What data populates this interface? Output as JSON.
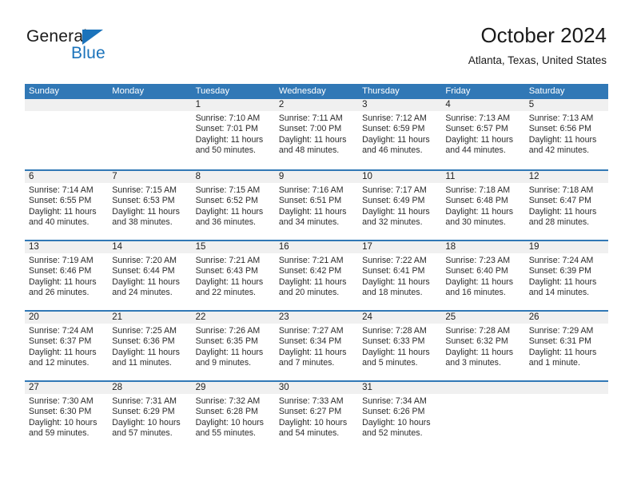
{
  "brand": {
    "name_top": "General",
    "name_bottom": "Blue",
    "color_dark": "#1a1a1a",
    "color_blue": "#1b73bb"
  },
  "header": {
    "title": "October 2024",
    "subtitle": "Atlanta, Texas, United States"
  },
  "theme": {
    "header_blue": "#3178b6",
    "daynum_band": "#f0f0f0",
    "text": "#2b2b2b"
  },
  "weekdays": [
    "Sunday",
    "Monday",
    "Tuesday",
    "Wednesday",
    "Thursday",
    "Friday",
    "Saturday"
  ],
  "weeks": [
    [
      {
        "day": "",
        "sunrise": "",
        "sunset": "",
        "daylight1": "",
        "daylight2": ""
      },
      {
        "day": "",
        "sunrise": "",
        "sunset": "",
        "daylight1": "",
        "daylight2": ""
      },
      {
        "day": "1",
        "sunrise": "Sunrise: 7:10 AM",
        "sunset": "Sunset: 7:01 PM",
        "daylight1": "Daylight: 11 hours",
        "daylight2": "and 50 minutes."
      },
      {
        "day": "2",
        "sunrise": "Sunrise: 7:11 AM",
        "sunset": "Sunset: 7:00 PM",
        "daylight1": "Daylight: 11 hours",
        "daylight2": "and 48 minutes."
      },
      {
        "day": "3",
        "sunrise": "Sunrise: 7:12 AM",
        "sunset": "Sunset: 6:59 PM",
        "daylight1": "Daylight: 11 hours",
        "daylight2": "and 46 minutes."
      },
      {
        "day": "4",
        "sunrise": "Sunrise: 7:13 AM",
        "sunset": "Sunset: 6:57 PM",
        "daylight1": "Daylight: 11 hours",
        "daylight2": "and 44 minutes."
      },
      {
        "day": "5",
        "sunrise": "Sunrise: 7:13 AM",
        "sunset": "Sunset: 6:56 PM",
        "daylight1": "Daylight: 11 hours",
        "daylight2": "and 42 minutes."
      }
    ],
    [
      {
        "day": "6",
        "sunrise": "Sunrise: 7:14 AM",
        "sunset": "Sunset: 6:55 PM",
        "daylight1": "Daylight: 11 hours",
        "daylight2": "and 40 minutes."
      },
      {
        "day": "7",
        "sunrise": "Sunrise: 7:15 AM",
        "sunset": "Sunset: 6:53 PM",
        "daylight1": "Daylight: 11 hours",
        "daylight2": "and 38 minutes."
      },
      {
        "day": "8",
        "sunrise": "Sunrise: 7:15 AM",
        "sunset": "Sunset: 6:52 PM",
        "daylight1": "Daylight: 11 hours",
        "daylight2": "and 36 minutes."
      },
      {
        "day": "9",
        "sunrise": "Sunrise: 7:16 AM",
        "sunset": "Sunset: 6:51 PM",
        "daylight1": "Daylight: 11 hours",
        "daylight2": "and 34 minutes."
      },
      {
        "day": "10",
        "sunrise": "Sunrise: 7:17 AM",
        "sunset": "Sunset: 6:49 PM",
        "daylight1": "Daylight: 11 hours",
        "daylight2": "and 32 minutes."
      },
      {
        "day": "11",
        "sunrise": "Sunrise: 7:18 AM",
        "sunset": "Sunset: 6:48 PM",
        "daylight1": "Daylight: 11 hours",
        "daylight2": "and 30 minutes."
      },
      {
        "day": "12",
        "sunrise": "Sunrise: 7:18 AM",
        "sunset": "Sunset: 6:47 PM",
        "daylight1": "Daylight: 11 hours",
        "daylight2": "and 28 minutes."
      }
    ],
    [
      {
        "day": "13",
        "sunrise": "Sunrise: 7:19 AM",
        "sunset": "Sunset: 6:46 PM",
        "daylight1": "Daylight: 11 hours",
        "daylight2": "and 26 minutes."
      },
      {
        "day": "14",
        "sunrise": "Sunrise: 7:20 AM",
        "sunset": "Sunset: 6:44 PM",
        "daylight1": "Daylight: 11 hours",
        "daylight2": "and 24 minutes."
      },
      {
        "day": "15",
        "sunrise": "Sunrise: 7:21 AM",
        "sunset": "Sunset: 6:43 PM",
        "daylight1": "Daylight: 11 hours",
        "daylight2": "and 22 minutes."
      },
      {
        "day": "16",
        "sunrise": "Sunrise: 7:21 AM",
        "sunset": "Sunset: 6:42 PM",
        "daylight1": "Daylight: 11 hours",
        "daylight2": "and 20 minutes."
      },
      {
        "day": "17",
        "sunrise": "Sunrise: 7:22 AM",
        "sunset": "Sunset: 6:41 PM",
        "daylight1": "Daylight: 11 hours",
        "daylight2": "and 18 minutes."
      },
      {
        "day": "18",
        "sunrise": "Sunrise: 7:23 AM",
        "sunset": "Sunset: 6:40 PM",
        "daylight1": "Daylight: 11 hours",
        "daylight2": "and 16 minutes."
      },
      {
        "day": "19",
        "sunrise": "Sunrise: 7:24 AM",
        "sunset": "Sunset: 6:39 PM",
        "daylight1": "Daylight: 11 hours",
        "daylight2": "and 14 minutes."
      }
    ],
    [
      {
        "day": "20",
        "sunrise": "Sunrise: 7:24 AM",
        "sunset": "Sunset: 6:37 PM",
        "daylight1": "Daylight: 11 hours",
        "daylight2": "and 12 minutes."
      },
      {
        "day": "21",
        "sunrise": "Sunrise: 7:25 AM",
        "sunset": "Sunset: 6:36 PM",
        "daylight1": "Daylight: 11 hours",
        "daylight2": "and 11 minutes."
      },
      {
        "day": "22",
        "sunrise": "Sunrise: 7:26 AM",
        "sunset": "Sunset: 6:35 PM",
        "daylight1": "Daylight: 11 hours",
        "daylight2": "and 9 minutes."
      },
      {
        "day": "23",
        "sunrise": "Sunrise: 7:27 AM",
        "sunset": "Sunset: 6:34 PM",
        "daylight1": "Daylight: 11 hours",
        "daylight2": "and 7 minutes."
      },
      {
        "day": "24",
        "sunrise": "Sunrise: 7:28 AM",
        "sunset": "Sunset: 6:33 PM",
        "daylight1": "Daylight: 11 hours",
        "daylight2": "and 5 minutes."
      },
      {
        "day": "25",
        "sunrise": "Sunrise: 7:28 AM",
        "sunset": "Sunset: 6:32 PM",
        "daylight1": "Daylight: 11 hours",
        "daylight2": "and 3 minutes."
      },
      {
        "day": "26",
        "sunrise": "Sunrise: 7:29 AM",
        "sunset": "Sunset: 6:31 PM",
        "daylight1": "Daylight: 11 hours",
        "daylight2": "and 1 minute."
      }
    ],
    [
      {
        "day": "27",
        "sunrise": "Sunrise: 7:30 AM",
        "sunset": "Sunset: 6:30 PM",
        "daylight1": "Daylight: 10 hours",
        "daylight2": "and 59 minutes."
      },
      {
        "day": "28",
        "sunrise": "Sunrise: 7:31 AM",
        "sunset": "Sunset: 6:29 PM",
        "daylight1": "Daylight: 10 hours",
        "daylight2": "and 57 minutes."
      },
      {
        "day": "29",
        "sunrise": "Sunrise: 7:32 AM",
        "sunset": "Sunset: 6:28 PM",
        "daylight1": "Daylight: 10 hours",
        "daylight2": "and 55 minutes."
      },
      {
        "day": "30",
        "sunrise": "Sunrise: 7:33 AM",
        "sunset": "Sunset: 6:27 PM",
        "daylight1": "Daylight: 10 hours",
        "daylight2": "and 54 minutes."
      },
      {
        "day": "31",
        "sunrise": "Sunrise: 7:34 AM",
        "sunset": "Sunset: 6:26 PM",
        "daylight1": "Daylight: 10 hours",
        "daylight2": "and 52 minutes."
      },
      {
        "day": "",
        "sunrise": "",
        "sunset": "",
        "daylight1": "",
        "daylight2": ""
      },
      {
        "day": "",
        "sunrise": "",
        "sunset": "",
        "daylight1": "",
        "daylight2": ""
      }
    ]
  ]
}
